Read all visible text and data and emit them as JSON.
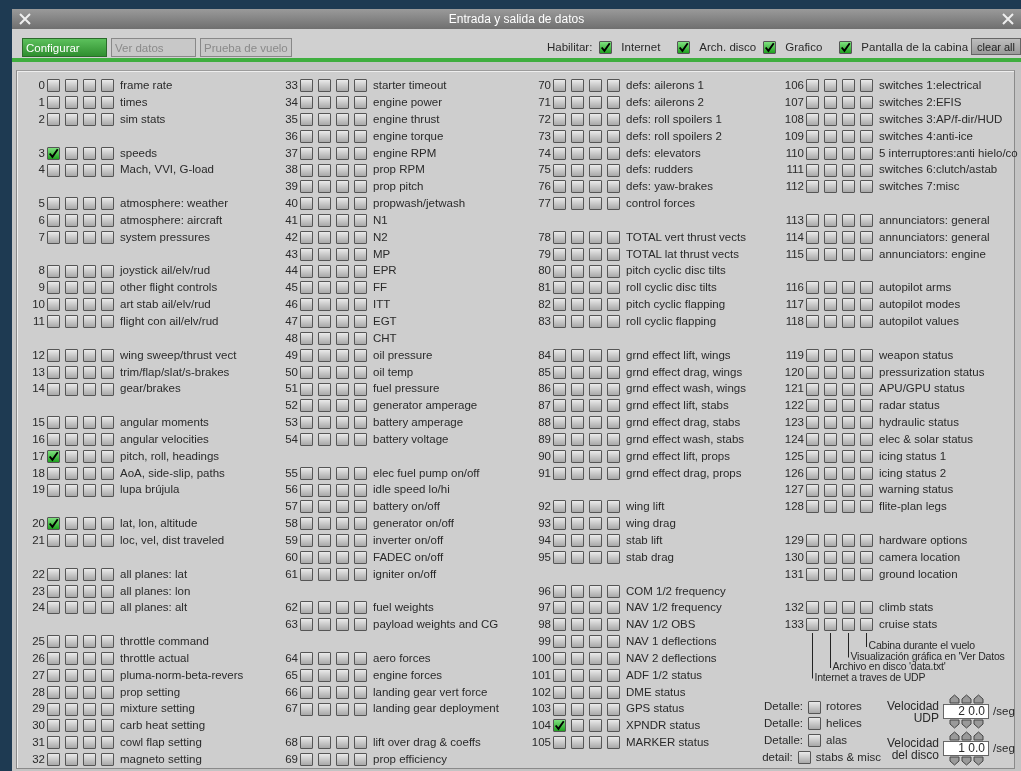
{
  "window": {
    "title": "Entrada y salida de datos"
  },
  "tabs": [
    {
      "label": "Configurar",
      "selected": true
    },
    {
      "label": "Ver datos",
      "selected": false
    },
    {
      "label": "Prueba de vuelo",
      "selected": false
    }
  ],
  "enable": {
    "label": "Habilitar:",
    "options": [
      {
        "label": "Internet",
        "checked": true
      },
      {
        "label": "Arch. disco",
        "checked": true
      },
      {
        "label": "Grafico",
        "checked": true
      },
      {
        "label": "Pantalla de la cabina",
        "checked": true
      }
    ]
  },
  "clear_button": "clear all",
  "columns": [
    {
      "groups": [
        {
          "rows": [
            {
              "index": "0",
              "label": "frame rate",
              "checked": [
                false,
                false,
                false,
                false
              ]
            },
            {
              "index": "1",
              "label": "times",
              "checked": [
                false,
                false,
                false,
                false
              ]
            },
            {
              "index": "2",
              "label": "sim stats",
              "checked": [
                false,
                false,
                false,
                false
              ]
            }
          ]
        },
        {
          "rows": [
            {
              "index": "3",
              "label": "speeds",
              "checked": [
                true,
                false,
                false,
                false
              ]
            },
            {
              "index": "4",
              "label": "Mach, VVI, G-load",
              "checked": [
                false,
                false,
                false,
                false
              ]
            }
          ]
        },
        {
          "rows": [
            {
              "index": "5",
              "label": "atmosphere: weather",
              "checked": [
                false,
                false,
                false,
                false
              ]
            },
            {
              "index": "6",
              "label": "atmosphere: aircraft",
              "checked": [
                false,
                false,
                false,
                false
              ]
            },
            {
              "index": "7",
              "label": "system pressures",
              "checked": [
                false,
                false,
                false,
                false
              ]
            }
          ]
        },
        {
          "rows": [
            {
              "index": "8",
              "label": "joystick ail/elv/rud",
              "checked": [
                false,
                false,
                false,
                false
              ]
            },
            {
              "index": "9",
              "label": "other flight controls",
              "checked": [
                false,
                false,
                false,
                false
              ]
            },
            {
              "index": "10",
              "label": "art stab ail/elv/rud",
              "checked": [
                false,
                false,
                false,
                false
              ]
            },
            {
              "index": "11",
              "label": "flight con ail/elv/rud",
              "checked": [
                false,
                false,
                false,
                false
              ]
            }
          ]
        },
        {
          "rows": [
            {
              "index": "12",
              "label": "wing sweep/thrust vect",
              "checked": [
                false,
                false,
                false,
                false
              ]
            },
            {
              "index": "13",
              "label": "trim/flap/slat/s-brakes",
              "checked": [
                false,
                false,
                false,
                false
              ]
            },
            {
              "index": "14",
              "label": "gear/brakes",
              "checked": [
                false,
                false,
                false,
                false
              ]
            }
          ]
        },
        {
          "rows": [
            {
              "index": "15",
              "label": "angular moments",
              "checked": [
                false,
                false,
                false,
                false
              ]
            },
            {
              "index": "16",
              "label": "angular velocities",
              "checked": [
                false,
                false,
                false,
                false
              ]
            },
            {
              "index": "17",
              "label": "pitch, roll, headings",
              "checked": [
                true,
                false,
                false,
                false
              ]
            },
            {
              "index": "18",
              "label": "AoA, side-slip, paths",
              "checked": [
                false,
                false,
                false,
                false
              ]
            },
            {
              "index": "19",
              "label": "lupa brújula",
              "checked": [
                false,
                false,
                false,
                false
              ]
            }
          ]
        },
        {
          "rows": [
            {
              "index": "20",
              "label": "lat, lon, altitude",
              "checked": [
                true,
                false,
                false,
                false
              ]
            },
            {
              "index": "21",
              "label": "loc, vel, dist traveled",
              "checked": [
                false,
                false,
                false,
                false
              ]
            }
          ]
        },
        {
          "rows": [
            {
              "index": "22",
              "label": "all planes: lat",
              "checked": [
                false,
                false,
                false,
                false
              ]
            },
            {
              "index": "23",
              "label": "all planes: lon",
              "checked": [
                false,
                false,
                false,
                false
              ]
            },
            {
              "index": "24",
              "label": "all planes: alt",
              "checked": [
                false,
                false,
                false,
                false
              ]
            }
          ]
        },
        {
          "rows": [
            {
              "index": "25",
              "label": "throttle command",
              "checked": [
                false,
                false,
                false,
                false
              ]
            },
            {
              "index": "26",
              "label": "throttle actual",
              "checked": [
                false,
                false,
                false,
                false
              ]
            },
            {
              "index": "27",
              "label": "pluma-norm-beta-revers",
              "checked": [
                false,
                false,
                false,
                false
              ]
            },
            {
              "index": "28",
              "label": "prop setting",
              "checked": [
                false,
                false,
                false,
                false
              ]
            },
            {
              "index": "29",
              "label": "mixture setting",
              "checked": [
                false,
                false,
                false,
                false
              ]
            },
            {
              "index": "30",
              "label": "carb heat setting",
              "checked": [
                false,
                false,
                false,
                false
              ]
            },
            {
              "index": "31",
              "label": "cowl flap setting",
              "checked": [
                false,
                false,
                false,
                false
              ]
            },
            {
              "index": "32",
              "label": "magneto setting",
              "checked": [
                false,
                false,
                false,
                false
              ]
            }
          ]
        }
      ]
    },
    {
      "groups": [
        {
          "rows": [
            {
              "index": "33",
              "label": "starter timeout",
              "checked": [
                false,
                false,
                false,
                false
              ]
            },
            {
              "index": "34",
              "label": "engine power",
              "checked": [
                false,
                false,
                false,
                false
              ]
            },
            {
              "index": "35",
              "label": "engine thrust",
              "checked": [
                false,
                false,
                false,
                false
              ]
            },
            {
              "index": "36",
              "label": "engine torque",
              "checked": [
                false,
                false,
                false,
                false
              ]
            },
            {
              "index": "37",
              "label": "engine RPM",
              "checked": [
                false,
                false,
                false,
                false
              ]
            },
            {
              "index": "38",
              "label": "prop RPM",
              "checked": [
                false,
                false,
                false,
                false
              ]
            },
            {
              "index": "39",
              "label": "prop pitch",
              "checked": [
                false,
                false,
                false,
                false
              ]
            },
            {
              "index": "40",
              "label": "propwash/jetwash",
              "checked": [
                false,
                false,
                false,
                false
              ]
            },
            {
              "index": "41",
              "label": "N1",
              "checked": [
                false,
                false,
                false,
                false
              ]
            },
            {
              "index": "42",
              "label": "N2",
              "checked": [
                false,
                false,
                false,
                false
              ]
            },
            {
              "index": "43",
              "label": "MP",
              "checked": [
                false,
                false,
                false,
                false
              ]
            },
            {
              "index": "44",
              "label": "EPR",
              "checked": [
                false,
                false,
                false,
                false
              ]
            },
            {
              "index": "45",
              "label": "FF",
              "checked": [
                false,
                false,
                false,
                false
              ]
            },
            {
              "index": "46",
              "label": "ITT",
              "checked": [
                false,
                false,
                false,
                false
              ]
            },
            {
              "index": "47",
              "label": "EGT",
              "checked": [
                false,
                false,
                false,
                false
              ]
            },
            {
              "index": "48",
              "label": "CHT",
              "checked": [
                false,
                false,
                false,
                false
              ]
            },
            {
              "index": "49",
              "label": "oil pressure",
              "checked": [
                false,
                false,
                false,
                false
              ]
            },
            {
              "index": "50",
              "label": "oil temp",
              "checked": [
                false,
                false,
                false,
                false
              ]
            },
            {
              "index": "51",
              "label": "fuel pressure",
              "checked": [
                false,
                false,
                false,
                false
              ]
            },
            {
              "index": "52",
              "label": "generator amperage",
              "checked": [
                false,
                false,
                false,
                false
              ]
            },
            {
              "index": "53",
              "label": "battery amperage",
              "checked": [
                false,
                false,
                false,
                false
              ]
            },
            {
              "index": "54",
              "label": "battery voltage",
              "checked": [
                false,
                false,
                false,
                false
              ]
            }
          ]
        },
        {
          "rows": [
            {
              "index": "55",
              "label": "elec fuel pump on/off",
              "checked": [
                false,
                false,
                false,
                false
              ]
            },
            {
              "index": "56",
              "label": "idle speed lo/hi",
              "checked": [
                false,
                false,
                false,
                false
              ]
            },
            {
              "index": "57",
              "label": "battery on/off",
              "checked": [
                false,
                false,
                false,
                false
              ]
            },
            {
              "index": "58",
              "label": "generator on/off",
              "checked": [
                false,
                false,
                false,
                false
              ]
            },
            {
              "index": "59",
              "label": "inverter on/off",
              "checked": [
                false,
                false,
                false,
                false
              ]
            },
            {
              "index": "60",
              "label": "FADEC on/off",
              "checked": [
                false,
                false,
                false,
                false
              ]
            },
            {
              "index": "61",
              "label": "igniter on/off",
              "checked": [
                false,
                false,
                false,
                false
              ]
            }
          ]
        },
        {
          "rows": [
            {
              "index": "62",
              "label": "fuel weights",
              "checked": [
                false,
                false,
                false,
                false
              ]
            },
            {
              "index": "63",
              "label": "payload weights and CG",
              "checked": [
                false,
                false,
                false,
                false
              ]
            }
          ]
        },
        {
          "rows": [
            {
              "index": "64",
              "label": "aero forces",
              "checked": [
                false,
                false,
                false,
                false
              ]
            },
            {
              "index": "65",
              "label": "engine forces",
              "checked": [
                false,
                false,
                false,
                false
              ]
            },
            {
              "index": "66",
              "label": "landing gear vert force",
              "checked": [
                false,
                false,
                false,
                false
              ]
            },
            {
              "index": "67",
              "label": "landing gear deployment",
              "checked": [
                false,
                false,
                false,
                false
              ]
            }
          ]
        },
        {
          "rows": [
            {
              "index": "68",
              "label": "lift over drag & coeffs",
              "checked": [
                false,
                false,
                false,
                false
              ]
            },
            {
              "index": "69",
              "label": "prop efficiency",
              "checked": [
                false,
                false,
                false,
                false
              ]
            }
          ]
        }
      ]
    },
    {
      "groups": [
        {
          "rows": [
            {
              "index": "70",
              "label": "defs: ailerons 1",
              "checked": [
                false,
                false,
                false,
                false
              ]
            },
            {
              "index": "71",
              "label": "defs: ailerons 2",
              "checked": [
                false,
                false,
                false,
                false
              ]
            },
            {
              "index": "72",
              "label": "defs: roll spoilers 1",
              "checked": [
                false,
                false,
                false,
                false
              ]
            },
            {
              "index": "73",
              "label": "defs: roll spoilers 2",
              "checked": [
                false,
                false,
                false,
                false
              ]
            },
            {
              "index": "74",
              "label": "defs: elevators",
              "checked": [
                false,
                false,
                false,
                false
              ]
            },
            {
              "index": "75",
              "label": "defs: rudders",
              "checked": [
                false,
                false,
                false,
                false
              ]
            },
            {
              "index": "76",
              "label": "defs: yaw-brakes",
              "checked": [
                false,
                false,
                false,
                false
              ]
            },
            {
              "index": "77",
              "label": "control forces",
              "checked": [
                false,
                false,
                false,
                false
              ]
            }
          ]
        },
        {
          "rows": [
            {
              "index": "78",
              "label": "TOTAL vert thrust vects",
              "checked": [
                false,
                false,
                false,
                false
              ]
            },
            {
              "index": "79",
              "label": "TOTAL lat  thrust vects",
              "checked": [
                false,
                false,
                false,
                false
              ]
            },
            {
              "index": "80",
              "label": "pitch cyclic disc tilts",
              "checked": [
                false,
                false,
                false,
                false
              ]
            },
            {
              "index": "81",
              "label": "roll cyclic disc tilts",
              "checked": [
                false,
                false,
                false,
                false
              ]
            },
            {
              "index": "82",
              "label": "pitch cyclic flapping",
              "checked": [
                false,
                false,
                false,
                false
              ]
            },
            {
              "index": "83",
              "label": "roll cyclic flapping",
              "checked": [
                false,
                false,
                false,
                false
              ]
            }
          ]
        },
        {
          "rows": [
            {
              "index": "84",
              "label": "grnd effect lift, wings",
              "checked": [
                false,
                false,
                false,
                false
              ]
            },
            {
              "index": "85",
              "label": "grnd effect drag, wings",
              "checked": [
                false,
                false,
                false,
                false
              ]
            },
            {
              "index": "86",
              "label": "grnd effect wash, wings",
              "checked": [
                false,
                false,
                false,
                false
              ]
            },
            {
              "index": "87",
              "label": "grnd effect lift, stabs",
              "checked": [
                false,
                false,
                false,
                false
              ]
            },
            {
              "index": "88",
              "label": "grnd effect drag, stabs",
              "checked": [
                false,
                false,
                false,
                false
              ]
            },
            {
              "index": "89",
              "label": "grnd effect wash, stabs",
              "checked": [
                false,
                false,
                false,
                false
              ]
            },
            {
              "index": "90",
              "label": "grnd effect lift, props",
              "checked": [
                false,
                false,
                false,
                false
              ]
            },
            {
              "index": "91",
              "label": "grnd effect drag, props",
              "checked": [
                false,
                false,
                false,
                false
              ]
            }
          ]
        },
        {
          "rows": [
            {
              "index": "92",
              "label": "wing lift",
              "checked": [
                false,
                false,
                false,
                false
              ]
            },
            {
              "index": "93",
              "label": "wing drag",
              "checked": [
                false,
                false,
                false,
                false
              ]
            },
            {
              "index": "94",
              "label": "stab lift",
              "checked": [
                false,
                false,
                false,
                false
              ]
            },
            {
              "index": "95",
              "label": "stab drag",
              "checked": [
                false,
                false,
                false,
                false
              ]
            }
          ]
        },
        {
          "rows": [
            {
              "index": "96",
              "label": "COM 1/2 frequency",
              "checked": [
                false,
                false,
                false,
                false
              ]
            },
            {
              "index": "97",
              "label": "NAV 1/2 frequency",
              "checked": [
                false,
                false,
                false,
                false
              ]
            },
            {
              "index": "98",
              "label": "NAV 1/2 OBS",
              "checked": [
                false,
                false,
                false,
                false
              ]
            },
            {
              "index": "99",
              "label": "NAV 1 deflections",
              "checked": [
                false,
                false,
                false,
                false
              ]
            },
            {
              "index": "100",
              "label": "NAV 2 deflections",
              "checked": [
                false,
                false,
                false,
                false
              ]
            },
            {
              "index": "101",
              "label": "ADF 1/2 status",
              "checked": [
                false,
                false,
                false,
                false
              ]
            },
            {
              "index": "102",
              "label": "DME status",
              "checked": [
                false,
                false,
                false,
                false
              ]
            },
            {
              "index": "103",
              "label": "GPS status",
              "checked": [
                false,
                false,
                false,
                false
              ]
            },
            {
              "index": "104",
              "label": "XPNDR status",
              "checked": [
                true,
                false,
                false,
                false
              ]
            },
            {
              "index": "105",
              "label": "MARKER status",
              "checked": [
                false,
                false,
                false,
                false
              ]
            }
          ]
        }
      ]
    },
    {
      "groups": [
        {
          "rows": [
            {
              "index": "106",
              "label": "switches 1:electrical",
              "checked": [
                false,
                false,
                false,
                false
              ]
            },
            {
              "index": "107",
              "label": "switches 2:EFIS",
              "checked": [
                false,
                false,
                false,
                false
              ]
            },
            {
              "index": "108",
              "label": "switches 3:AP/f-dir/HUD",
              "checked": [
                false,
                false,
                false,
                false
              ]
            },
            {
              "index": "109",
              "label": "switches 4:anti-ice",
              "checked": [
                false,
                false,
                false,
                false
              ]
            },
            {
              "index": "110",
              "label": "5 interruptores:anti hielo/co",
              "checked": [
                false,
                false,
                false,
                false
              ]
            },
            {
              "index": "111",
              "label": "switches 6:clutch/astab",
              "checked": [
                false,
                false,
                false,
                false
              ]
            },
            {
              "index": "112",
              "label": "switches 7:misc",
              "checked": [
                false,
                false,
                false,
                false
              ]
            }
          ]
        },
        {
          "rows": [
            {
              "index": "113",
              "label": "annunciators: general",
              "checked": [
                false,
                false,
                false,
                false
              ]
            },
            {
              "index": "114",
              "label": "annunciators: general",
              "checked": [
                false,
                false,
                false,
                false
              ]
            },
            {
              "index": "115",
              "label": "annunciators: engine",
              "checked": [
                false,
                false,
                false,
                false
              ]
            }
          ]
        },
        {
          "rows": [
            {
              "index": "116",
              "label": "autopilot arms",
              "checked": [
                false,
                false,
                false,
                false
              ]
            },
            {
              "index": "117",
              "label": "autopilot modes",
              "checked": [
                false,
                false,
                false,
                false
              ]
            },
            {
              "index": "118",
              "label": "autopilot values",
              "checked": [
                false,
                false,
                false,
                false
              ]
            }
          ]
        },
        {
          "rows": [
            {
              "index": "119",
              "label": "weapon status",
              "checked": [
                false,
                false,
                false,
                false
              ]
            },
            {
              "index": "120",
              "label": "pressurization status",
              "checked": [
                false,
                false,
                false,
                false
              ]
            },
            {
              "index": "121",
              "label": "APU/GPU status",
              "checked": [
                false,
                false,
                false,
                false
              ]
            },
            {
              "index": "122",
              "label": "radar status",
              "checked": [
                false,
                false,
                false,
                false
              ]
            },
            {
              "index": "123",
              "label": "hydraulic status",
              "checked": [
                false,
                false,
                false,
                false
              ]
            },
            {
              "index": "124",
              "label": "elec & solar status",
              "checked": [
                false,
                false,
                false,
                false
              ]
            },
            {
              "index": "125",
              "label": "icing status 1",
              "checked": [
                false,
                false,
                false,
                false
              ]
            },
            {
              "index": "126",
              "label": "icing status 2",
              "checked": [
                false,
                false,
                false,
                false
              ]
            },
            {
              "index": "127",
              "label": "warning status",
              "checked": [
                false,
                false,
                false,
                false
              ]
            },
            {
              "index": "128",
              "label": "flite-plan legs",
              "checked": [
                false,
                false,
                false,
                false
              ]
            }
          ]
        },
        {
          "rows": [
            {
              "index": "129",
              "label": "hardware options",
              "checked": [
                false,
                false,
                false,
                false
              ]
            },
            {
              "index": "130",
              "label": "camera location",
              "checked": [
                false,
                false,
                false,
                false
              ]
            },
            {
              "index": "131",
              "label": "ground location",
              "checked": [
                false,
                false,
                false,
                false
              ]
            }
          ]
        },
        {
          "rows": [
            {
              "index": "132",
              "label": "climb stats",
              "checked": [
                false,
                false,
                false,
                false
              ]
            },
            {
              "index": "133",
              "label": "cruise stats",
              "checked": [
                false,
                false,
                false,
                false
              ]
            }
          ]
        }
      ]
    }
  ],
  "legend": [
    "Cabina durante el vuelo",
    "Visualización gráfica en 'Ver Datos",
    "Archivo en disco 'data.txt'",
    "Internet a traves de UDP"
  ],
  "details": [
    {
      "prefix": "Detalle:",
      "label": "rotores",
      "checked": false
    },
    {
      "prefix": "Detalle:",
      "label": "helices",
      "checked": false
    },
    {
      "prefix": "Detalle:",
      "label": "alas",
      "checked": false
    },
    {
      "prefix": "detail:",
      "label": "stabs & misc",
      "checked": false
    }
  ],
  "rates": [
    {
      "label_lines": [
        "Velocidad",
        "UDP"
      ],
      "value": "2 0.0",
      "unit": "/seg"
    },
    {
      "label_lines": [
        "Velocidad",
        "del disco"
      ],
      "value": "1 0.0",
      "unit": "/seg"
    }
  ]
}
